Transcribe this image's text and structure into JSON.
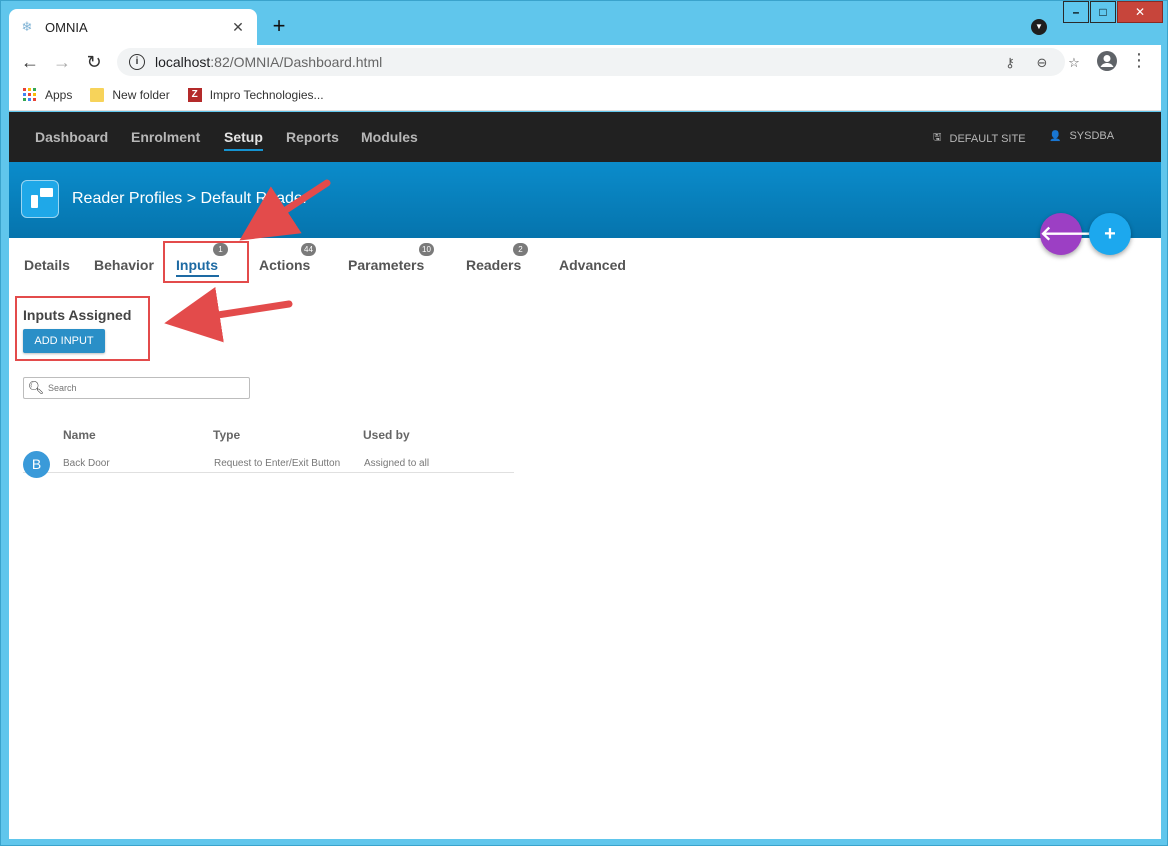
{
  "browser": {
    "tab_title": "OMNIA",
    "tab_close": "✕",
    "new_tab": "+",
    "url_host": "localhost",
    "url_path": ":82/OMNIA/Dashboard.html",
    "bookmarks": [
      {
        "label": "Apps"
      },
      {
        "label": "New folder"
      },
      {
        "label": "Impro Technologies..."
      }
    ]
  },
  "nav": {
    "items": [
      "Dashboard",
      "Enrolment",
      "Setup",
      "Reports",
      "Modules"
    ],
    "active": "Setup",
    "site_label": "DEFAULT SITE",
    "user_label": "SYSDBA"
  },
  "header": {
    "breadcrumb": "Reader Profiles  >  Default Reader"
  },
  "subtabs": [
    {
      "label": "Details",
      "badge": null
    },
    {
      "label": "Behavior",
      "badge": null
    },
    {
      "label": "Inputs",
      "badge": "1"
    },
    {
      "label": "Actions",
      "badge": "44"
    },
    {
      "label": "Parameters",
      "badge": "10"
    },
    {
      "label": "Readers",
      "badge": "2"
    },
    {
      "label": "Advanced",
      "badge": null
    }
  ],
  "section": {
    "title": "Inputs Assigned",
    "add_button": "ADD INPUT",
    "search_placeholder": "Search"
  },
  "table": {
    "columns": [
      "Name",
      "Type",
      "Used by"
    ],
    "rows": [
      {
        "avatar": "B",
        "name": "Back Door",
        "type": "Request to Enter/Exit Button",
        "used_by": "Assigned to all"
      }
    ]
  },
  "colors": {
    "nav_bg": "#212121",
    "banner": "#0b8ccb",
    "accent": "#1d6aa3",
    "fab_back": "#9c3fc4",
    "fab_add": "#1ca8ee",
    "annotation": "#e34b4b"
  }
}
